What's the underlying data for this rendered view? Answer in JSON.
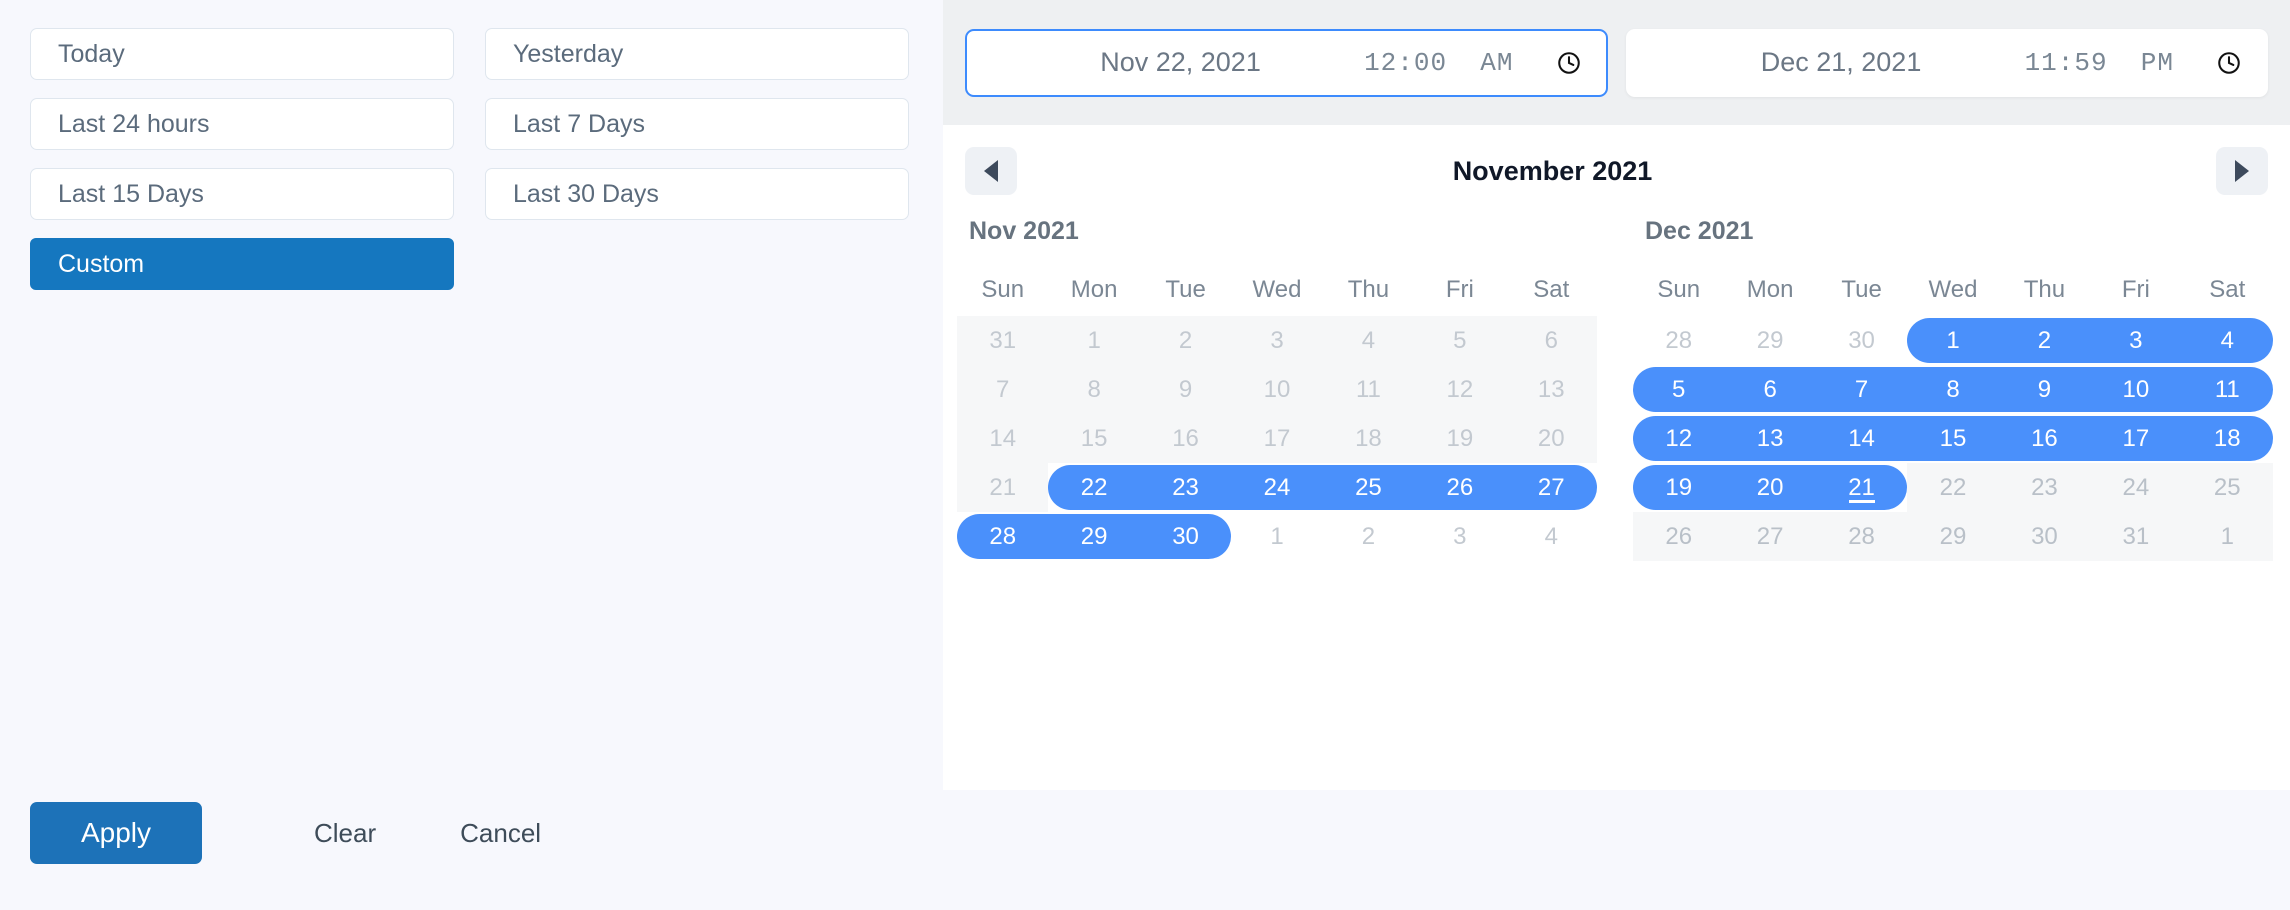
{
  "quick_ranges": [
    {
      "label": "Today",
      "active": false
    },
    {
      "label": "Yesterday",
      "active": false
    },
    {
      "label": "Last 24 hours",
      "active": false
    },
    {
      "label": "Last 7 Days",
      "active": false
    },
    {
      "label": "Last 15 Days",
      "active": false
    },
    {
      "label": "Last 30 Days",
      "active": false
    },
    {
      "label": "Custom",
      "active": true
    }
  ],
  "footer": {
    "apply_label": "Apply",
    "clear_label": "Clear",
    "cancel_label": "Cancel"
  },
  "inputs": {
    "start": {
      "date": "Nov 22, 2021",
      "time": "12:00  AM",
      "focused": true,
      "icon": "clock-icon"
    },
    "end": {
      "date": "Dec 21, 2021",
      "time": "11:59  PM",
      "focused": false,
      "icon": "clock-icon"
    }
  },
  "nav": {
    "prev_icon": "chevron-left-icon",
    "next_icon": "chevron-right-icon",
    "title": "November 2021"
  },
  "weekdays": [
    "Sun",
    "Mon",
    "Tue",
    "Wed",
    "Thu",
    "Fri",
    "Sat"
  ],
  "colors": {
    "accent_range": "#4a90fb",
    "accent_button": "#1577bf",
    "apply_button": "#1d72b8",
    "focus_border": "#3d8bfd",
    "page_background": "#f7f8fd",
    "header_band": "#eef0f2",
    "disabled_block": "#f6f7f8"
  },
  "selection": {
    "start_date": "2021-11-22",
    "end_date": "2021-12-21"
  },
  "months": [
    {
      "label": "Nov 2021",
      "weeks": [
        [
          {
            "n": "31",
            "state": "muted"
          },
          {
            "n": "1",
            "state": "muted"
          },
          {
            "n": "2",
            "state": "muted"
          },
          {
            "n": "3",
            "state": "muted"
          },
          {
            "n": "4",
            "state": "muted"
          },
          {
            "n": "5",
            "state": "muted"
          },
          {
            "n": "6",
            "state": "muted"
          }
        ],
        [
          {
            "n": "7",
            "state": "muted"
          },
          {
            "n": "8",
            "state": "muted"
          },
          {
            "n": "9",
            "state": "muted"
          },
          {
            "n": "10",
            "state": "muted"
          },
          {
            "n": "11",
            "state": "muted"
          },
          {
            "n": "12",
            "state": "muted"
          },
          {
            "n": "13",
            "state": "muted"
          }
        ],
        [
          {
            "n": "14",
            "state": "muted"
          },
          {
            "n": "15",
            "state": "muted"
          },
          {
            "n": "16",
            "state": "muted"
          },
          {
            "n": "17",
            "state": "muted"
          },
          {
            "n": "18",
            "state": "muted"
          },
          {
            "n": "19",
            "state": "muted"
          },
          {
            "n": "20",
            "state": "muted"
          }
        ],
        [
          {
            "n": "21",
            "state": "muted"
          },
          {
            "n": "22",
            "state": "range-start"
          },
          {
            "n": "23",
            "state": "range"
          },
          {
            "n": "24",
            "state": "range"
          },
          {
            "n": "25",
            "state": "range"
          },
          {
            "n": "26",
            "state": "range"
          },
          {
            "n": "27",
            "state": "range"
          }
        ],
        [
          {
            "n": "28",
            "state": "range"
          },
          {
            "n": "29",
            "state": "range"
          },
          {
            "n": "30",
            "state": "range-end-row"
          },
          {
            "n": "1",
            "state": "muted"
          },
          {
            "n": "2",
            "state": "muted"
          },
          {
            "n": "3",
            "state": "muted"
          },
          {
            "n": "4",
            "state": "muted"
          }
        ]
      ]
    },
    {
      "label": "Dec 2021",
      "weeks": [
        [
          {
            "n": "28",
            "state": "muted"
          },
          {
            "n": "29",
            "state": "muted"
          },
          {
            "n": "30",
            "state": "muted"
          },
          {
            "n": "1",
            "state": "range-start-row"
          },
          {
            "n": "2",
            "state": "range"
          },
          {
            "n": "3",
            "state": "range"
          },
          {
            "n": "4",
            "state": "range"
          }
        ],
        [
          {
            "n": "5",
            "state": "range"
          },
          {
            "n": "6",
            "state": "range"
          },
          {
            "n": "7",
            "state": "range"
          },
          {
            "n": "8",
            "state": "range"
          },
          {
            "n": "9",
            "state": "range"
          },
          {
            "n": "10",
            "state": "range"
          },
          {
            "n": "11",
            "state": "range"
          }
        ],
        [
          {
            "n": "12",
            "state": "range"
          },
          {
            "n": "13",
            "state": "range"
          },
          {
            "n": "14",
            "state": "range"
          },
          {
            "n": "15",
            "state": "range"
          },
          {
            "n": "16",
            "state": "range"
          },
          {
            "n": "17",
            "state": "range"
          },
          {
            "n": "18",
            "state": "range"
          }
        ],
        [
          {
            "n": "19",
            "state": "range"
          },
          {
            "n": "20",
            "state": "range"
          },
          {
            "n": "21",
            "state": "range-end",
            "today": true
          },
          {
            "n": "22",
            "state": "disabled"
          },
          {
            "n": "23",
            "state": "disabled"
          },
          {
            "n": "24",
            "state": "disabled"
          },
          {
            "n": "25",
            "state": "disabled"
          }
        ],
        [
          {
            "n": "26",
            "state": "disabled"
          },
          {
            "n": "27",
            "state": "disabled"
          },
          {
            "n": "28",
            "state": "disabled"
          },
          {
            "n": "29",
            "state": "disabled"
          },
          {
            "n": "30",
            "state": "disabled"
          },
          {
            "n": "31",
            "state": "disabled"
          },
          {
            "n": "1",
            "state": "disabled"
          }
        ]
      ]
    }
  ]
}
